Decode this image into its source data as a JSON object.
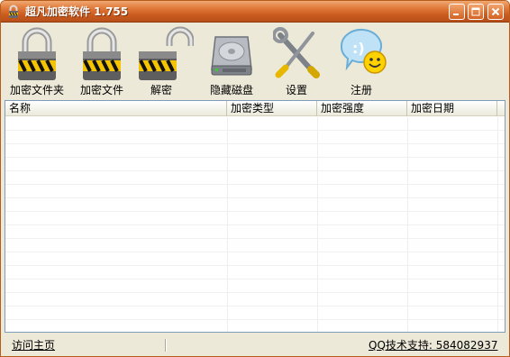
{
  "window": {
    "title": "超凡加密软件 1.755",
    "colors": {
      "titlebar": "#c95a1e",
      "background": "#ece9d8",
      "list_border": "#7f9db9"
    }
  },
  "toolbar": {
    "items": [
      {
        "label": "加密文件夹",
        "icon": "lock-closed-icon"
      },
      {
        "label": "加密文件",
        "icon": "lock-closed-icon"
      },
      {
        "label": "解密",
        "icon": "lock-open-icon"
      },
      {
        "label": "隐藏磁盘",
        "icon": "hard-disk-icon"
      },
      {
        "label": "设置",
        "icon": "tools-icon"
      },
      {
        "label": "注册",
        "icon": "register-smiley-icon"
      }
    ]
  },
  "list": {
    "columns": [
      "名称",
      "加密类型",
      "加密强度",
      "加密日期"
    ],
    "rows": []
  },
  "status": {
    "home_link": "访问主页",
    "support_text": "QQ技术支持: 584082937"
  }
}
